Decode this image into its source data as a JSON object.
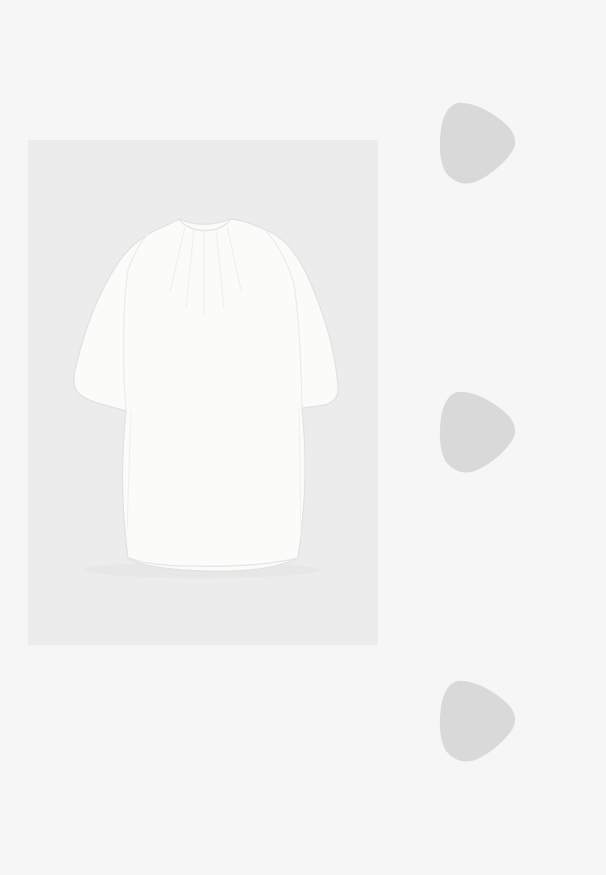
{
  "colors": {
    "page_background": "#f6f6f6",
    "image_background": "#ececec",
    "placeholder": "#d9d9d9",
    "garment": "#fbfbfa"
  },
  "product": {
    "image_subject": "white-puff-sleeve-mini-dress"
  },
  "thumbnails": [
    {
      "icon": "image-placeholder-icon",
      "state": "loading"
    },
    {
      "icon": "image-placeholder-icon",
      "state": "loading"
    },
    {
      "icon": "image-placeholder-icon",
      "state": "loading"
    }
  ]
}
